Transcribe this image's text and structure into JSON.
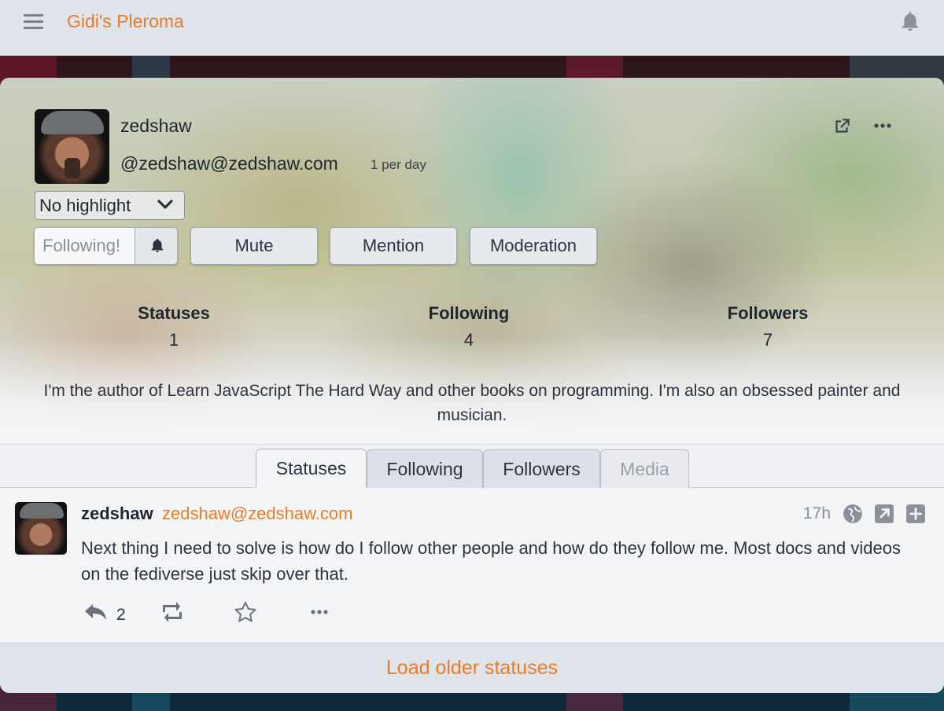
{
  "topbar": {
    "site_title": "Gidi's Pleroma",
    "menu_icon": "hamburger-icon",
    "notifications_icon": "bell-icon"
  },
  "profile": {
    "username": "zedshaw",
    "handle": "@zedshaw@zedshaw.com",
    "rate": "1 per day",
    "highlight_select": "No highlight",
    "buttons": {
      "following": "Following!",
      "mute": "Mute",
      "mention": "Mention",
      "moderation": "Moderation"
    },
    "stats": [
      {
        "label": "Statuses",
        "value": "1"
      },
      {
        "label": "Following",
        "value": "4"
      },
      {
        "label": "Followers",
        "value": "7"
      }
    ],
    "bio": "I'm the author of Learn JavaScript The Hard Way and other books on programming. I'm also an obsessed painter and musician."
  },
  "tabs": [
    {
      "label": "Statuses",
      "active": true
    },
    {
      "label": "Following",
      "active": false
    },
    {
      "label": "Followers",
      "active": false
    },
    {
      "label": "Media",
      "active": false,
      "disabled": true
    }
  ],
  "status": {
    "name": "zedshaw",
    "handle": "zedshaw@zedshaw.com",
    "time": "17h",
    "text": "Next thing I need to solve is how do I follow other people and how do they follow me. Most docs and videos on the fediverse just skip over that.",
    "reply_count": "2"
  },
  "footer": {
    "load_older": "Load older statuses"
  },
  "colors": {
    "accent": "#e87b2c",
    "text": "#1f2630",
    "bar": "#dfe3ea"
  }
}
